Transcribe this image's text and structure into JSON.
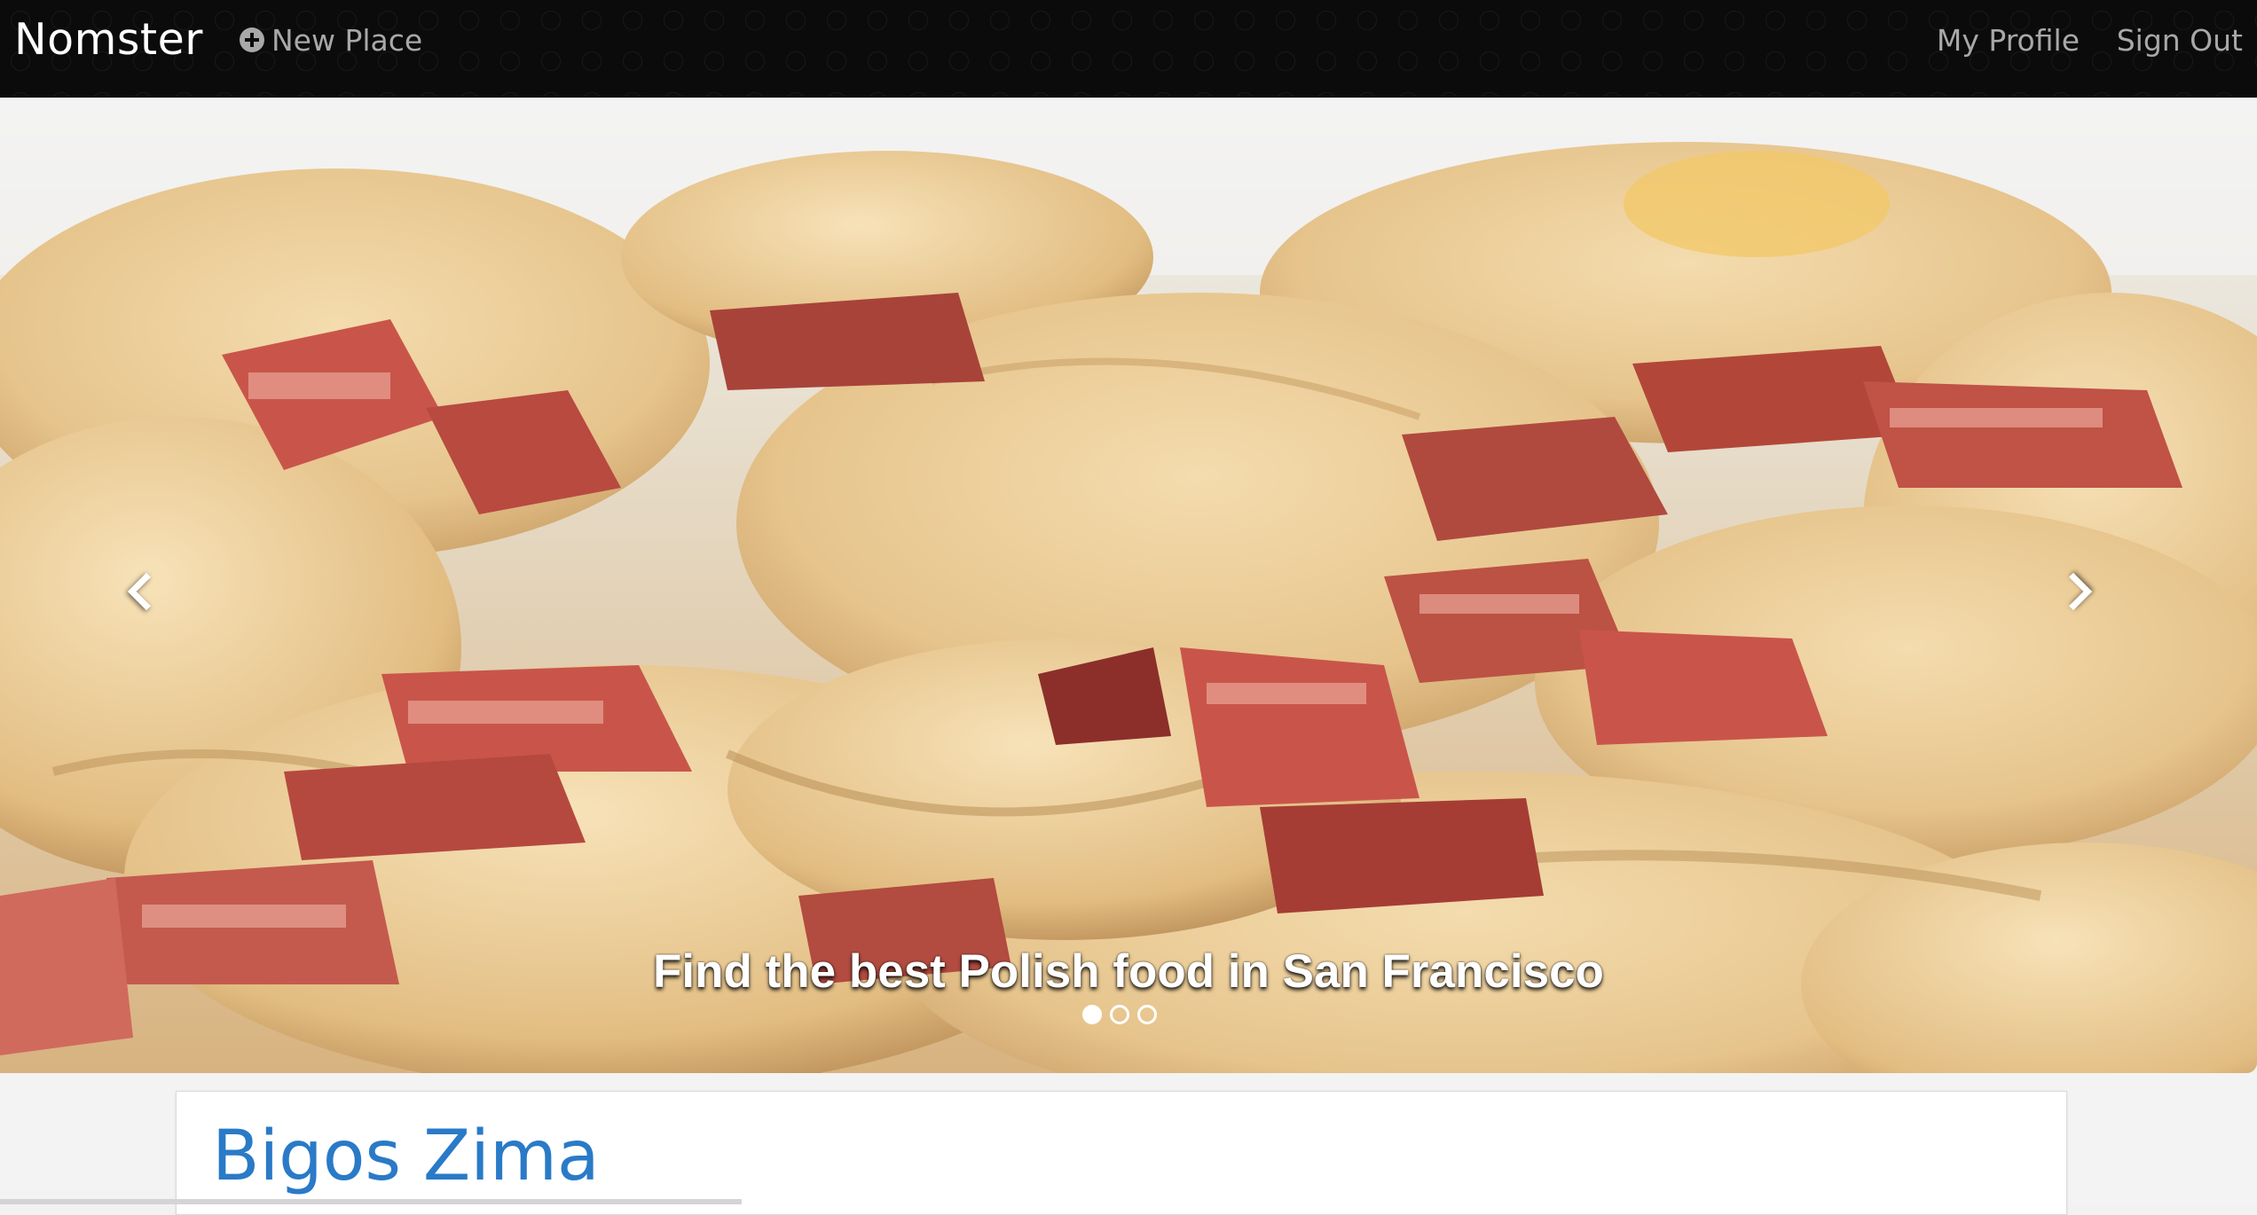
{
  "navbar": {
    "brand": "Nomster",
    "new_place": "New Place",
    "new_place_icon": "plus-circle-icon",
    "my_profile": "My Profile",
    "sign_out": "Sign Out"
  },
  "carousel": {
    "caption": "Find the best Polish food in San Francisco",
    "slide_count": 3,
    "active_slide": 1,
    "prev_icon": "chevron-left-icon",
    "next_icon": "chevron-right-icon"
  },
  "places": [
    {
      "name": "Bigos Zima"
    }
  ],
  "colors": {
    "navbar_bg": "#0b0b0b",
    "nav_link": "#a8a8a8",
    "title_link": "#2a7ac7"
  }
}
